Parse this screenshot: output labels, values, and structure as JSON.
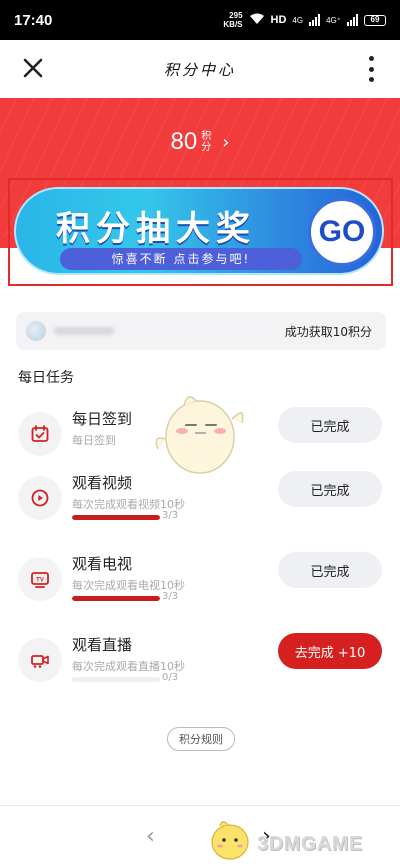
{
  "status_bar": {
    "time": "17:40",
    "net_speed_value": "295",
    "net_speed_unit": "KB/S",
    "hd_label": "HD",
    "net_type_1": "4G",
    "net_type_2": "4G⁺",
    "battery": "69"
  },
  "nav": {
    "title": "积分中心",
    "close_icon": "close-icon",
    "more_icon": "more-vertical-icon"
  },
  "header": {
    "points_value": "80",
    "points_unit": "积分",
    "points_arrow": "›"
  },
  "banner": {
    "title": "积分抽大奖",
    "subtitle": "惊喜不断 点击参与吧!",
    "go_label": "GO"
  },
  "notice": {
    "text": "成功获取10积分"
  },
  "tasks_section": {
    "title": "每日任务",
    "items": [
      {
        "icon": "calendar-icon",
        "name": "每日签到",
        "desc": "每日签到",
        "button": "已完成",
        "completed": true
      },
      {
        "icon": "play-icon",
        "name": "观看视频",
        "desc": "每次完成观看视频10秒",
        "button": "已完成",
        "completed": true,
        "progress_text": "3/3",
        "progress": 1.0
      },
      {
        "icon": "tv-icon",
        "name": "观看电视",
        "desc": "每次完成观看电视10秒",
        "button": "已完成",
        "completed": true,
        "progress_text": "3/3",
        "progress": 1.0
      },
      {
        "icon": "live-camera-icon",
        "name": "观看直播",
        "desc": "每次完成观看直播10秒",
        "button": "去完成 +10",
        "completed": false,
        "progress_text": "0/3",
        "progress": 0.0
      }
    ]
  },
  "rules_label": "积分规则",
  "bottom_nav": {
    "back": "‹",
    "forward": "›"
  },
  "watermark": "3DMGAME",
  "colors": {
    "brand_red": "#d62020",
    "header_red": "#f23b3b",
    "banner_blue": "#2f8ee0"
  }
}
